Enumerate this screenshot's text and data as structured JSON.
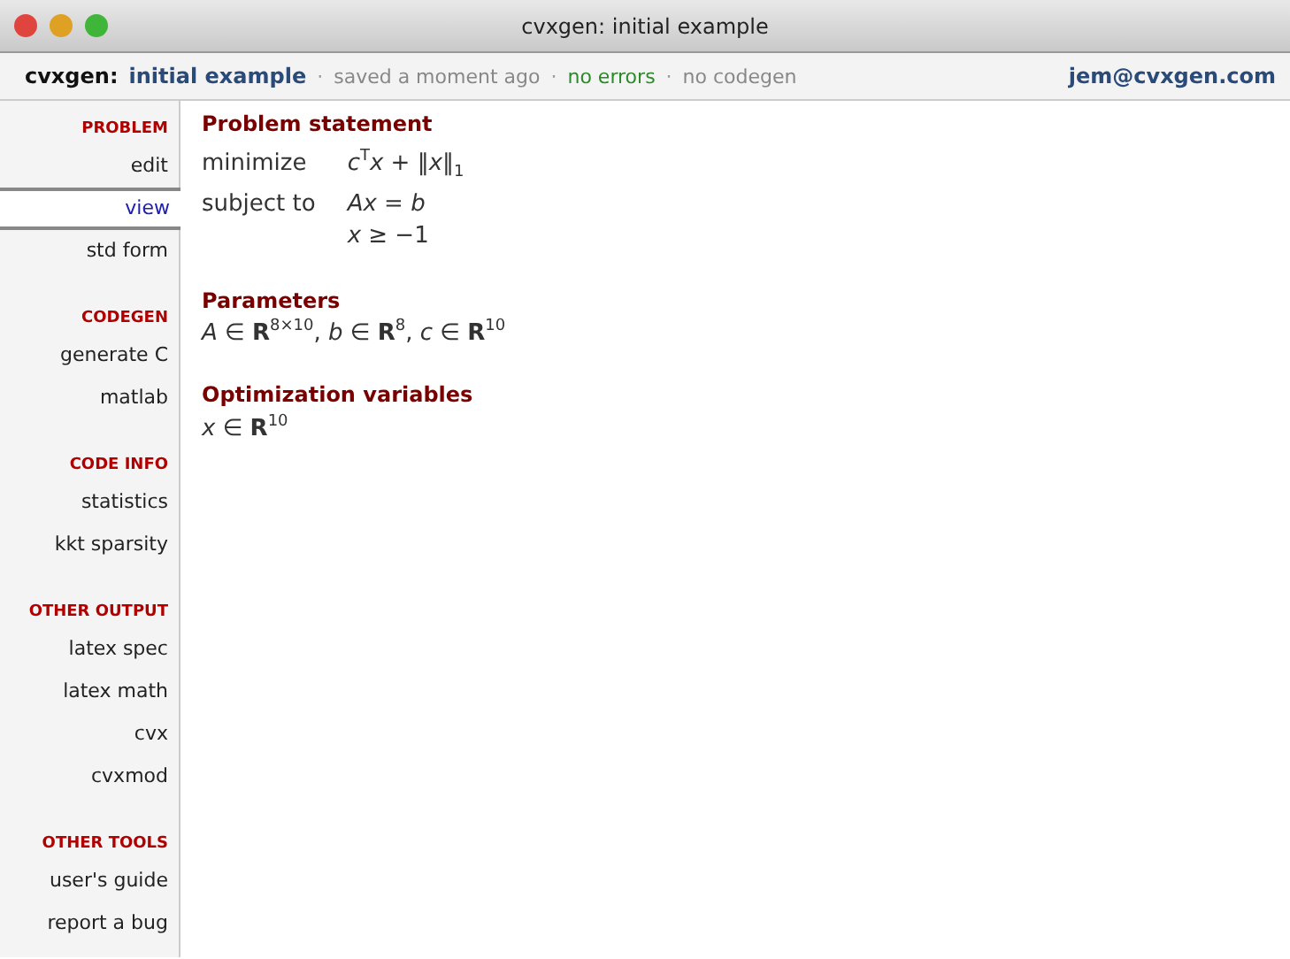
{
  "window": {
    "title": "cvxgen: initial example"
  },
  "header": {
    "app": "cvxgen:",
    "project": "initial example",
    "status": [
      {
        "text": "saved a moment ago",
        "kind": "neutral"
      },
      {
        "text": "no errors",
        "kind": "ok"
      },
      {
        "text": "no codegen",
        "kind": "neutral"
      }
    ],
    "separator": "·",
    "user": "jem@cvxgen.com"
  },
  "sidebar": {
    "sections": [
      {
        "heading": "PROBLEM",
        "items": [
          {
            "label": "edit",
            "selected": false
          },
          {
            "label": "view",
            "selected": true
          },
          {
            "label": "std form",
            "selected": false
          }
        ]
      },
      {
        "heading": "CODEGEN",
        "items": [
          {
            "label": "generate C",
            "selected": false
          },
          {
            "label": "matlab",
            "selected": false
          }
        ]
      },
      {
        "heading": "CODE INFO",
        "items": [
          {
            "label": "statistics",
            "selected": false
          },
          {
            "label": "kkt sparsity",
            "selected": false
          }
        ]
      },
      {
        "heading": "OTHER OUTPUT",
        "items": [
          {
            "label": "latex spec",
            "selected": false
          },
          {
            "label": "latex math",
            "selected": false
          },
          {
            "label": "cvx",
            "selected": false
          },
          {
            "label": "cvxmod",
            "selected": false
          }
        ]
      },
      {
        "heading": "OTHER TOOLS",
        "items": [
          {
            "label": "user's guide",
            "selected": false
          },
          {
            "label": "report a bug",
            "selected": false
          }
        ]
      }
    ]
  },
  "content": {
    "sections": [
      {
        "title": "Problem statement",
        "kind": "problem",
        "rows": [
          {
            "label": "minimize",
            "expr": "*c*$^{T}$*x* + ‖*x*‖$_{1}$"
          },
          {
            "label": "subject to",
            "expr": "*Ax* = *b*"
          },
          {
            "expr": "*x* ≥ −1"
          }
        ]
      },
      {
        "title": "Parameters",
        "kind": "text",
        "text": "*A* ∈ **R**$^{8×10}$, *b* ∈ **R**$^{8}$, *c* ∈ **R**$^{10}$"
      },
      {
        "title": "Optimization variables",
        "kind": "text",
        "text": "*x* ∈ **R**$^{10}$"
      }
    ]
  }
}
